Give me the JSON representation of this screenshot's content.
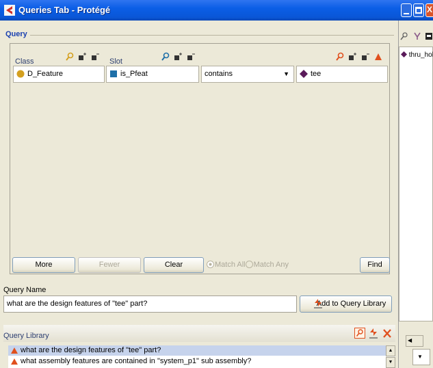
{
  "window": {
    "title": "Queries Tab - Protégé"
  },
  "query": {
    "section_title": "Query",
    "headers": {
      "class": "Class",
      "slot": "Slot"
    },
    "row": {
      "class_value": "D_Feature",
      "slot_value": "is_Pfeat",
      "operator": "contains",
      "value": "tee"
    },
    "buttons": {
      "more": "More",
      "fewer": "Fewer",
      "clear": "Clear",
      "find": "Find"
    },
    "match": {
      "all": "Match All",
      "any": "Match Any",
      "selected": "all"
    }
  },
  "query_name": {
    "label": "Query Name",
    "value": "what are the design features of \"tee\" part?",
    "add_button": "Add to Query Library"
  },
  "library": {
    "title": "Query Library",
    "items": [
      "what are the design features of \"tee\" part?",
      "what assembly features are contained in \"system_p1\" sub assembly?"
    ],
    "selected_index": 0
  },
  "right_pane": {
    "instance": "thru_hole"
  },
  "colors": {
    "accent": "#1a40b0",
    "class_icon": "#d4a020",
    "slot_icon": "#1e6fa8",
    "instance_icon": "#5a1a5a",
    "selection": "#c6d3ec",
    "warn": "#e0501e"
  }
}
